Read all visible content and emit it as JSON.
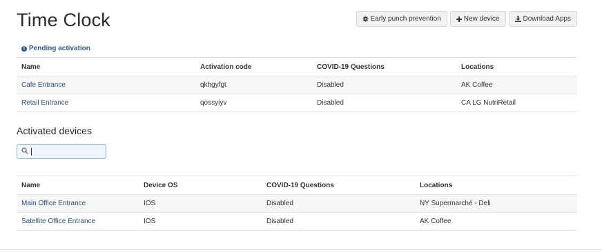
{
  "page": {
    "title": "Time Clock"
  },
  "toolbar": {
    "early_punch_label": "Early punch prevention",
    "new_device_label": "New device",
    "download_apps_label": "Download Apps"
  },
  "pending": {
    "heading": "Pending activation",
    "columns": [
      "Name",
      "Activation code",
      "COVID-19 Questions",
      "Locations"
    ],
    "rows": [
      {
        "name": "Cafe Entrance",
        "code": "qkhgyfgt",
        "covid": "Disabled",
        "location": "AK Coffee"
      },
      {
        "name": "Retail Entrance",
        "code": "qossyiyv",
        "covid": "Disabled",
        "location": "CA LG NutriRetail"
      }
    ]
  },
  "activated": {
    "heading": "Activated devices",
    "search": {
      "value": "",
      "placeholder": ""
    },
    "columns": [
      "Name",
      "Device OS",
      "COVID-19 Questions",
      "Locations"
    ],
    "rows": [
      {
        "name": "Main Office Entrance",
        "os": "IOS",
        "covid": "Disabled",
        "location": "NY Supermarché - Deli"
      },
      {
        "name": "Satellite Office Entrance",
        "os": "IOS",
        "covid": "Disabled",
        "location": "AK Coffee"
      }
    ]
  },
  "icons": {
    "early_punch": "gear-icon",
    "new_device": "plus-icon",
    "download_apps": "download-icon",
    "pending": "info-icon",
    "search": "search-icon"
  },
  "colors": {
    "link": "#2b4f73",
    "pending_heading": "#2f5f8a",
    "search_border": "#8fb3d6"
  }
}
